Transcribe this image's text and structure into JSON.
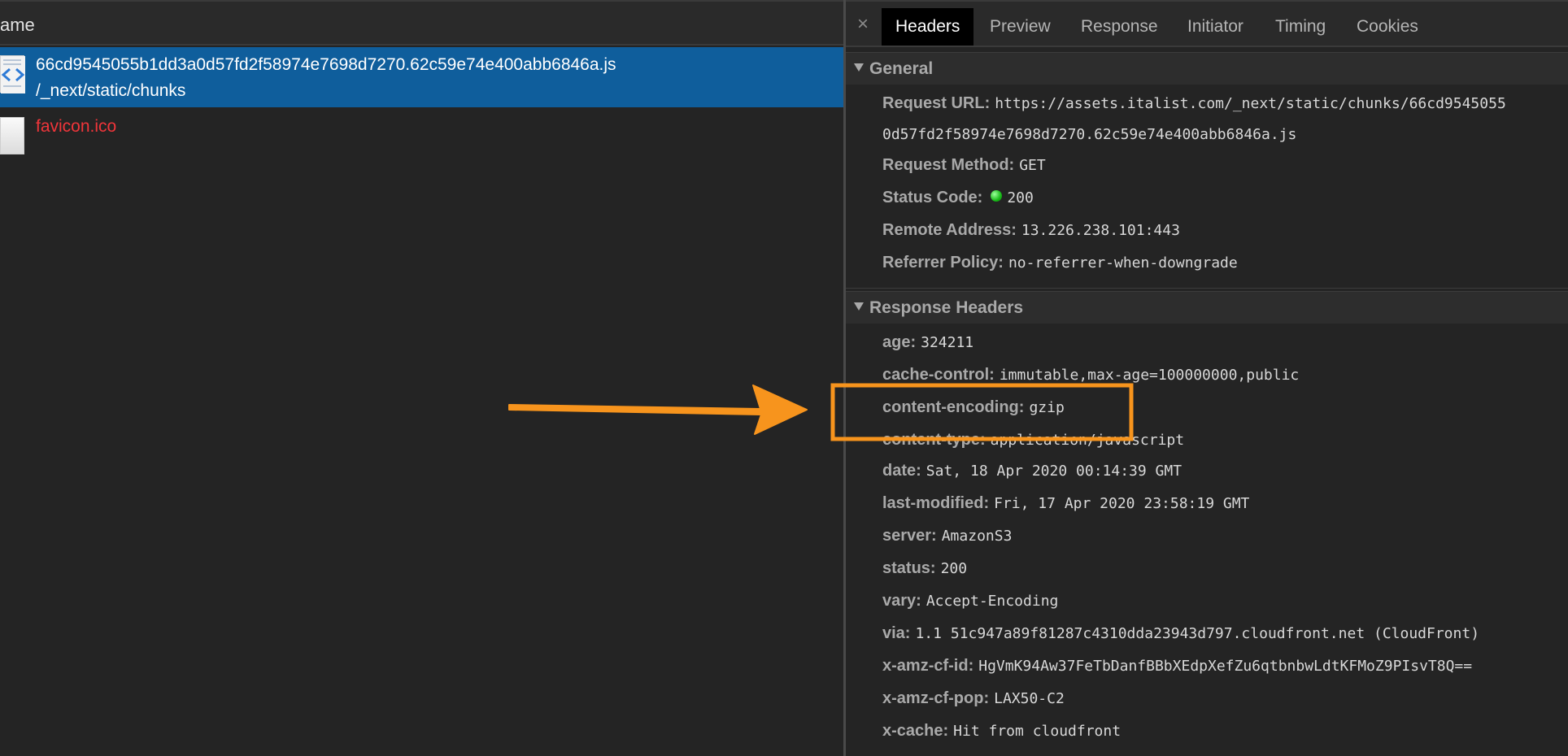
{
  "request_list": {
    "column_header": "ame",
    "requests": [
      {
        "name": "66cd9545055b1dd3a0d57fd2f58974e7698d7270.62c59e74e400abb6846a.js",
        "path": "/_next/static/chunks"
      },
      {
        "name": "favicon.ico"
      }
    ]
  },
  "tabs": [
    {
      "label": "Headers",
      "active": true
    },
    {
      "label": "Preview"
    },
    {
      "label": "Response"
    },
    {
      "label": "Initiator"
    },
    {
      "label": "Timing"
    },
    {
      "label": "Cookies"
    }
  ],
  "close_glyph": "×",
  "general": {
    "title": "General",
    "request_url_key": "Request URL:",
    "request_url_line1": "https://assets.italist.com/_next/static/chunks/66cd9545055",
    "request_url_line2": "0d57fd2f58974e7698d7270.62c59e74e400abb6846a.js",
    "method_key": "Request Method:",
    "method_value": "GET",
    "status_key": "Status Code:",
    "status_value": "200",
    "status_color": "#18b918",
    "remote_key": "Remote Address:",
    "remote_value": "13.226.238.101:443",
    "referrer_key": "Referrer Policy:",
    "referrer_value": "no-referrer-when-downgrade"
  },
  "response_headers": {
    "title": "Response Headers",
    "items": [
      {
        "key": "age:",
        "value": "324211"
      },
      {
        "key": "cache-control:",
        "value": "immutable,max-age=100000000,public"
      },
      {
        "key": "content-encoding:",
        "value": "gzip"
      },
      {
        "key": "content-type:",
        "value": "application/javascript"
      },
      {
        "key": "date:",
        "value": "Sat, 18 Apr 2020 00:14:39 GMT"
      },
      {
        "key": "last-modified:",
        "value": "Fri, 17 Apr 2020 23:58:19 GMT"
      },
      {
        "key": "server:",
        "value": "AmazonS3"
      },
      {
        "key": "status:",
        "value": "200"
      },
      {
        "key": "vary:",
        "value": "Accept-Encoding"
      },
      {
        "key": "via:",
        "value": "1.1 51c947a89f81287c4310dda23943d797.cloudfront.net (CloudFront)"
      },
      {
        "key": "x-amz-cf-id:",
        "value": "HgVmK94Aw37FeTbDanfBBbXEdpXefZu6qtbnbwLdtKFMoZ9PIsvT8Q=="
      },
      {
        "key": "x-amz-cf-pop:",
        "value": "LAX50-C2"
      },
      {
        "key": "x-cache:",
        "value": "Hit from cloudfront"
      }
    ]
  },
  "annotation": {
    "color": "#f7941d",
    "highlighted_header": "content-encoding:"
  }
}
